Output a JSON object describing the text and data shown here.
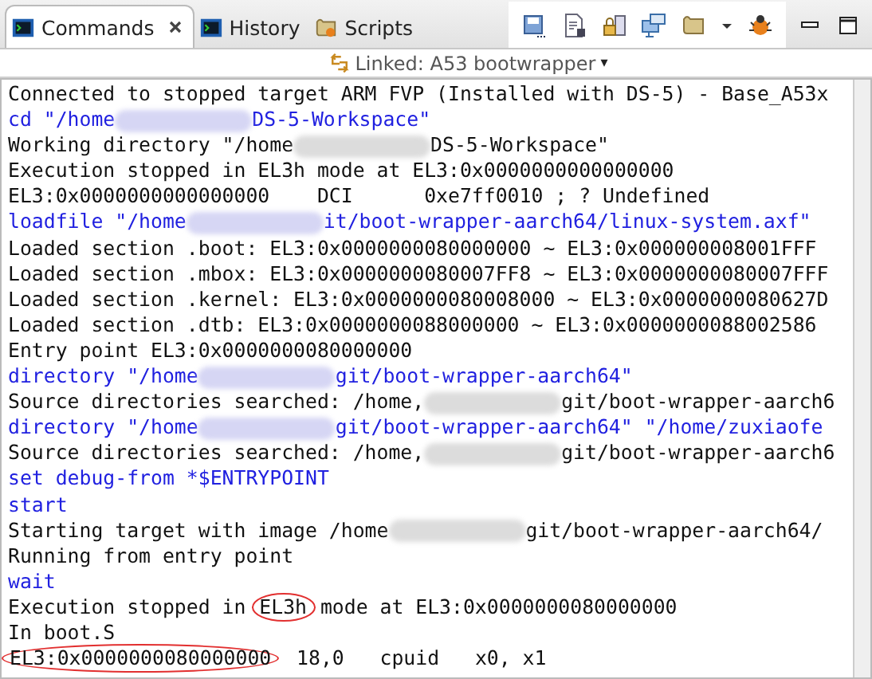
{
  "tabs": [
    {
      "label": "Commands",
      "selected": true
    },
    {
      "label": "History",
      "selected": false
    },
    {
      "label": "Scripts",
      "selected": false
    }
  ],
  "link_bar": {
    "label": "Linked: A53 bootwrapper",
    "caret": "▾"
  },
  "console": {
    "lines": [
      {
        "kind": "output",
        "parts": [
          {
            "kind": "text",
            "text": "Connected to stopped target ARM FVP (Installed with DS-5) - Base_A53x"
          }
        ]
      },
      {
        "kind": "command",
        "parts": [
          {
            "kind": "text",
            "text": "cd \"/home"
          },
          {
            "kind": "redacted"
          },
          {
            "kind": "text",
            "text": "DS-5-Workspace\""
          }
        ]
      },
      {
        "kind": "output",
        "parts": [
          {
            "kind": "text",
            "text": "Working directory \"/home"
          },
          {
            "kind": "redacted"
          },
          {
            "kind": "text",
            "text": "DS-5-Workspace\""
          }
        ]
      },
      {
        "kind": "output",
        "parts": [
          {
            "kind": "text",
            "text": "Execution stopped in EL3h mode at EL3:0x0000000000000000"
          }
        ]
      },
      {
        "kind": "output",
        "parts": [
          {
            "kind": "text",
            "text": "EL3:0x0000000000000000    DCI      0xe7ff0010 ; ? Undefined"
          }
        ]
      },
      {
        "kind": "command",
        "parts": [
          {
            "kind": "text",
            "text": "loadfile \"/home"
          },
          {
            "kind": "redacted"
          },
          {
            "kind": "text",
            "text": "it/boot-wrapper-aarch64/linux-system.axf\""
          }
        ]
      },
      {
        "kind": "output",
        "parts": [
          {
            "kind": "text",
            "text": "Loaded section .boot: EL3:0x0000000080000000 ~ EL3:0x000000008001FFF"
          }
        ]
      },
      {
        "kind": "output",
        "parts": [
          {
            "kind": "text",
            "text": "Loaded section .mbox: EL3:0x0000000080007FF8 ~ EL3:0x0000000080007FFF"
          }
        ]
      },
      {
        "kind": "output",
        "parts": [
          {
            "kind": "text",
            "text": "Loaded section .kernel: EL3:0x0000000080008000 ~ EL3:0x0000000080627D"
          }
        ]
      },
      {
        "kind": "output",
        "parts": [
          {
            "kind": "text",
            "text": "Loaded section .dtb: EL3:0x0000000088000000 ~ EL3:0x0000000088002586"
          }
        ]
      },
      {
        "kind": "output",
        "parts": [
          {
            "kind": "text",
            "text": "Entry point EL3:0x0000000080000000"
          }
        ]
      },
      {
        "kind": "command",
        "parts": [
          {
            "kind": "text",
            "text": "directory \"/home"
          },
          {
            "kind": "redacted"
          },
          {
            "kind": "text",
            "text": "git/boot-wrapper-aarch64\""
          }
        ]
      },
      {
        "kind": "output",
        "parts": [
          {
            "kind": "text",
            "text": "Source directories searched: /home,"
          },
          {
            "kind": "redacted"
          },
          {
            "kind": "text",
            "text": "git/boot-wrapper-aarch6"
          }
        ]
      },
      {
        "kind": "command",
        "parts": [
          {
            "kind": "text",
            "text": "directory \"/home"
          },
          {
            "kind": "redacted"
          },
          {
            "kind": "text",
            "text": "git/boot-wrapper-aarch64\" \"/home/zuxiaofe"
          }
        ]
      },
      {
        "kind": "output",
        "parts": [
          {
            "kind": "text",
            "text": "Source directories searched: /home,"
          },
          {
            "kind": "redacted"
          },
          {
            "kind": "text",
            "text": "git/boot-wrapper-aarch6"
          }
        ]
      },
      {
        "kind": "command",
        "parts": [
          {
            "kind": "text",
            "text": "set debug-from *$ENTRYPOINT"
          }
        ]
      },
      {
        "kind": "command",
        "parts": [
          {
            "kind": "text",
            "text": "start"
          }
        ]
      },
      {
        "kind": "output",
        "parts": [
          {
            "kind": "text",
            "text": "Starting target with image /home"
          },
          {
            "kind": "redacted"
          },
          {
            "kind": "text",
            "text": "git/boot-wrapper-aarch64/"
          }
        ]
      },
      {
        "kind": "output",
        "parts": [
          {
            "kind": "text",
            "text": "Running from entry point"
          }
        ]
      },
      {
        "kind": "command",
        "parts": [
          {
            "kind": "text",
            "text": "wait"
          }
        ]
      },
      {
        "kind": "output",
        "parts": [
          {
            "kind": "text",
            "text": "Execution stopped in "
          },
          {
            "kind": "circled",
            "text": "EL3h"
          },
          {
            "kind": "text",
            "text": " mode at EL3:0x0000000080000000"
          }
        ]
      },
      {
        "kind": "output",
        "parts": [
          {
            "kind": "text",
            "text": "In boot.S"
          }
        ]
      },
      {
        "kind": "output",
        "parts": [
          {
            "kind": "circled",
            "text": "EL3:0x0000000080000000"
          },
          {
            "kind": "text",
            "text": "  18,0   cpuid   x0, x1"
          }
        ]
      }
    ]
  }
}
